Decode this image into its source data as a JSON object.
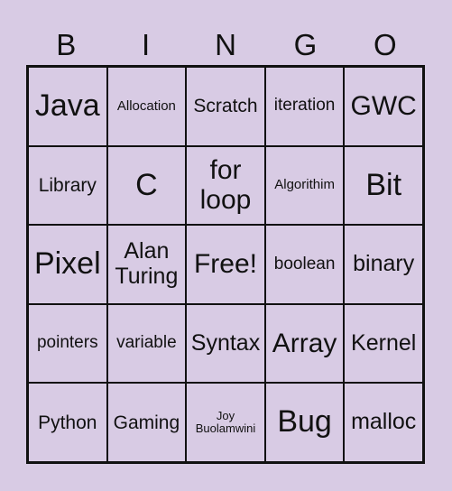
{
  "header": [
    "B",
    "I",
    "N",
    "G",
    "O"
  ],
  "cells": [
    {
      "text": "Java",
      "size": "s-xl"
    },
    {
      "text": "Allocation",
      "size": "s-xs"
    },
    {
      "text": "Scratch",
      "size": "s-sm"
    },
    {
      "text": "iteration",
      "size": "s-s"
    },
    {
      "text": "GWC",
      "size": "s-l"
    },
    {
      "text": "Library",
      "size": "s-sm"
    },
    {
      "text": "C",
      "size": "s-xl"
    },
    {
      "text": "for loop",
      "size": "s-l"
    },
    {
      "text": "Algorithim",
      "size": "s-xs"
    },
    {
      "text": "Bit",
      "size": "s-xl"
    },
    {
      "text": "Pixel",
      "size": "s-xl"
    },
    {
      "text": "Alan Turing",
      "size": "s-m"
    },
    {
      "text": "Free!",
      "size": "s-l"
    },
    {
      "text": "boolean",
      "size": "s-s"
    },
    {
      "text": "binary",
      "size": "s-m"
    },
    {
      "text": "pointers",
      "size": "s-s"
    },
    {
      "text": "variable",
      "size": "s-s"
    },
    {
      "text": "Syntax",
      "size": "s-m"
    },
    {
      "text": "Array",
      "size": "s-l"
    },
    {
      "text": "Kernel",
      "size": "s-m"
    },
    {
      "text": "Python",
      "size": "s-sm"
    },
    {
      "text": "Gaming",
      "size": "s-sm"
    },
    {
      "text": "Joy Buolamwini",
      "size": "s-xxs"
    },
    {
      "text": "Bug",
      "size": "s-xl"
    },
    {
      "text": "malloc",
      "size": "s-m"
    }
  ]
}
